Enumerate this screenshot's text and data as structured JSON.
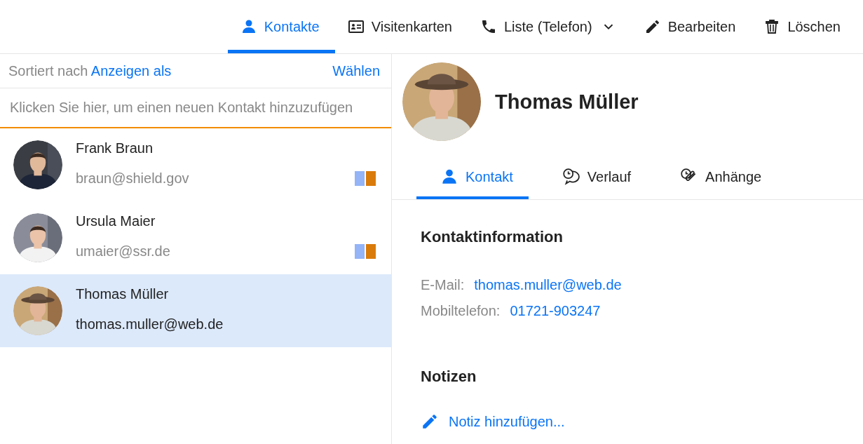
{
  "toolbar": {
    "items": [
      {
        "label": "Kontakte",
        "selected": true,
        "dropdown": false
      },
      {
        "label": "Visitenkarten",
        "selected": false,
        "dropdown": false
      },
      {
        "label": "Liste (Telefon)",
        "selected": false,
        "dropdown": true
      },
      {
        "label": "Bearbeiten",
        "selected": false,
        "dropdown": false
      },
      {
        "label": "Löschen",
        "selected": false,
        "dropdown": false
      }
    ]
  },
  "list_header": {
    "sort_label": "Sortiert nach",
    "sort_link": "Anzeigen als",
    "select_link": "Wählen"
  },
  "add_contact": {
    "placeholder": "Klicken Sie hier, um einen neuen Kontakt hinzuzufügen"
  },
  "contacts": [
    {
      "name": "Frank Braun",
      "email": "braun@shield.gov",
      "selected": false,
      "avatar": {
        "kind": "picture"
      },
      "tags": [
        {
          "color": "#94b4f7"
        },
        {
          "color": "#d97b0b"
        }
      ]
    },
    {
      "name": "Ursula Maier",
      "email": "umaier@ssr.de",
      "selected": false,
      "avatar": {
        "kind": "picture"
      },
      "tags": [
        {
          "color": "#94b4f7"
        },
        {
          "color": "#d97b0b"
        }
      ]
    },
    {
      "name": "Thomas Müller",
      "email": "thomas.muller@web.de",
      "selected": true,
      "avatar": {
        "kind": "picture"
      }
    }
  ],
  "detail": {
    "name": "Thomas Müller",
    "avatar": {
      "kind": "picture"
    },
    "tabs": [
      {
        "label": "Kontakt",
        "selected": true
      },
      {
        "label": "Verlauf",
        "selected": false
      },
      {
        "label": "Anhänge",
        "selected": false
      }
    ],
    "sections": [
      {
        "title": "Kontaktinformation",
        "fields": [
          {
            "label": "E-Mail:",
            "value": "thomas.muller@web.de"
          },
          {
            "label": "Mobiltelefon:",
            "value": "01721-903247"
          }
        ]
      },
      {
        "title": "Notizen",
        "action": "Notiz hinzufügen..."
      }
    ]
  }
}
